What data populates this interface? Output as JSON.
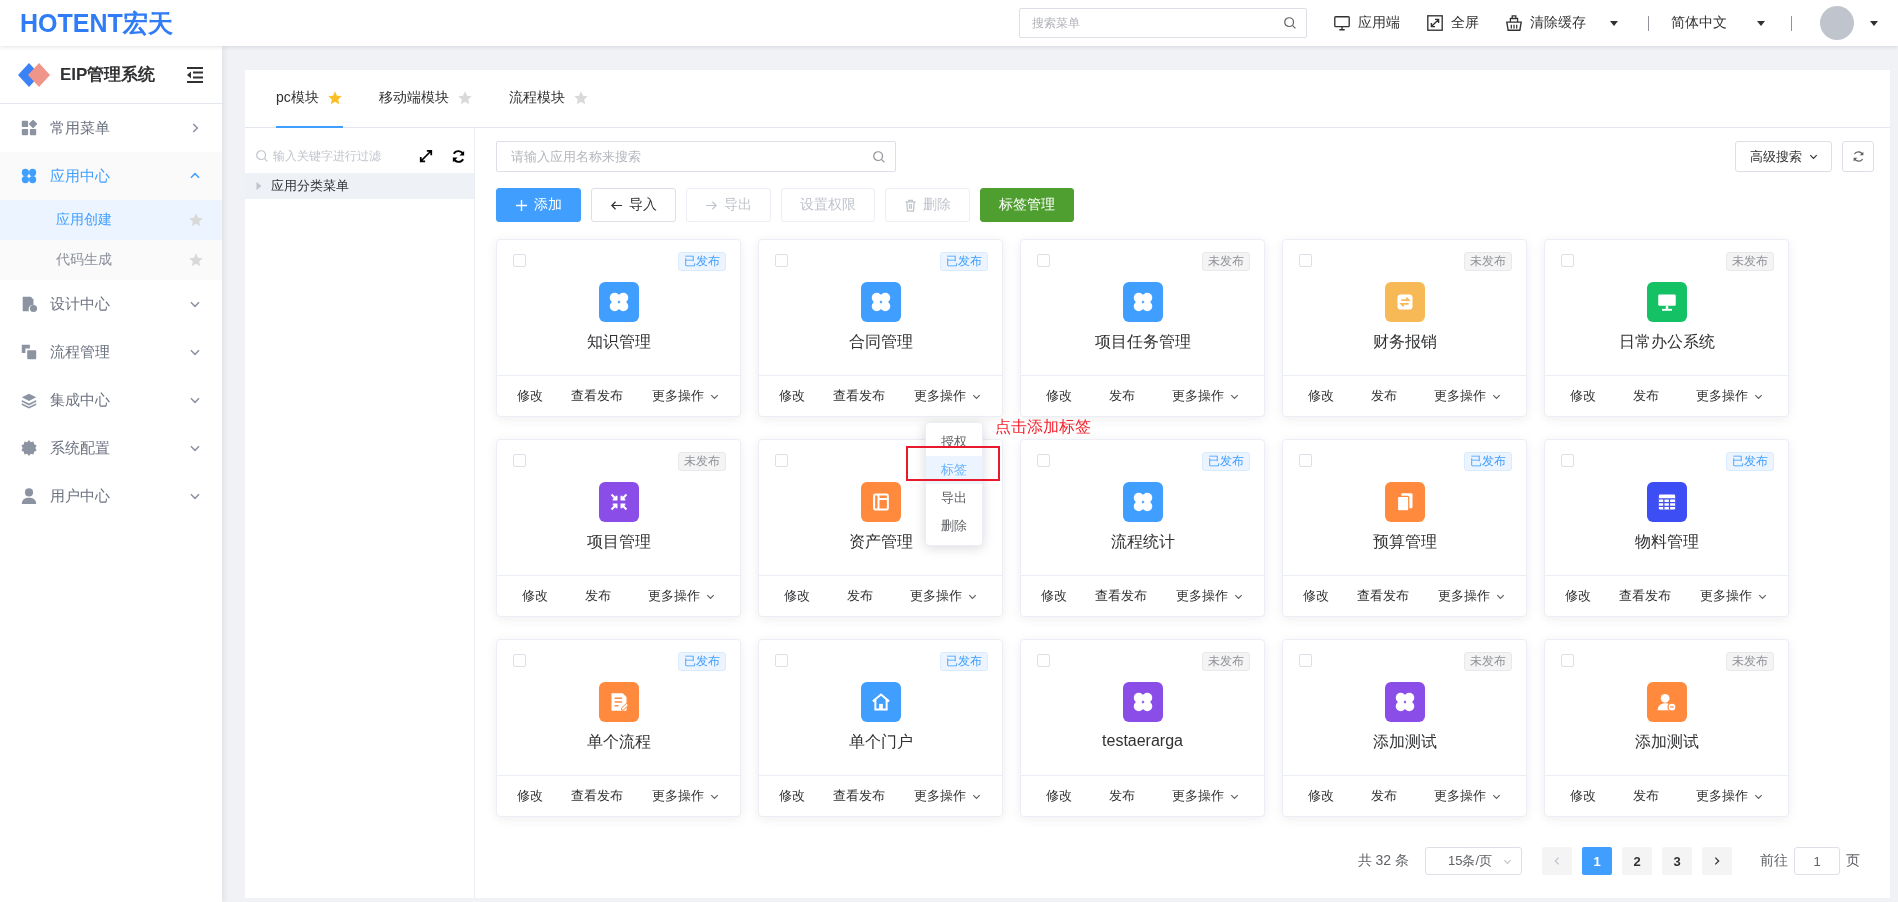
{
  "header": {
    "logo": "HOTENT宏天",
    "search": {
      "placeholder": "搜索菜单"
    },
    "actions": [
      {
        "label": "应用端",
        "caret": false
      },
      {
        "label": "全屏",
        "caret": false
      },
      {
        "label": "清除缓存",
        "caret": true
      }
    ],
    "language": {
      "label": "简体中文"
    }
  },
  "sidebar": {
    "title": "EIP管理系统",
    "items": [
      {
        "label": "常用菜单",
        "kind": "flyout",
        "expanded": false,
        "selected": false
      },
      {
        "label": "应用中心",
        "kind": "group",
        "expanded": true,
        "selected": true,
        "children": [
          {
            "label": "应用创建",
            "selected": true,
            "favorite": false
          },
          {
            "label": "代码生成",
            "selected": false,
            "favorite": false
          }
        ]
      },
      {
        "label": "设计中心",
        "kind": "group",
        "expanded": false,
        "selected": false
      },
      {
        "label": "流程管理",
        "kind": "group",
        "expanded": false,
        "selected": false
      },
      {
        "label": "集成中心",
        "kind": "group",
        "expanded": false,
        "selected": false
      },
      {
        "label": "系统配置",
        "kind": "group",
        "expanded": false,
        "selected": false
      },
      {
        "label": "用户中心",
        "kind": "group",
        "expanded": false,
        "selected": false
      }
    ]
  },
  "tabs": [
    {
      "label": "pc模块",
      "selected": true,
      "favorite": true
    },
    {
      "label": "移动端模块",
      "selected": false,
      "favorite": false
    },
    {
      "label": "流程模块",
      "selected": false,
      "favorite": false
    }
  ],
  "tree": {
    "filter": {
      "placeholder": "输入关键字进行过滤"
    },
    "nodes": [
      {
        "label": "应用分类菜单",
        "expanded": false,
        "selected": true
      }
    ]
  },
  "search": {
    "placeholder": "请输入应用名称来搜索"
  },
  "advanced_search": {
    "label": "高级搜索"
  },
  "toolbar": [
    {
      "label": "添加",
      "kind": "primary",
      "disabled": false
    },
    {
      "label": "导入",
      "kind": "default",
      "disabled": false
    },
    {
      "label": "导出",
      "kind": "default",
      "disabled": true
    },
    {
      "label": "设置权限",
      "kind": "default",
      "disabled": true
    },
    {
      "label": "删除",
      "kind": "default",
      "disabled": true
    },
    {
      "label": "标签管理",
      "kind": "success",
      "disabled": false
    }
  ],
  "cards": [
    {
      "name": "知识管理",
      "status": "已发布",
      "published": true,
      "checked": false,
      "color": "#409eff",
      "actions": [
        "修改",
        "查看发布",
        "更多操作"
      ]
    },
    {
      "name": "合同管理",
      "status": "已发布",
      "published": true,
      "checked": false,
      "color": "#409eff",
      "actions": [
        "修改",
        "查看发布",
        "更多操作"
      ]
    },
    {
      "name": "项目任务管理",
      "status": "未发布",
      "published": false,
      "checked": false,
      "color": "#409eff",
      "actions": [
        "修改",
        "发布",
        "更多操作"
      ]
    },
    {
      "name": "财务报销",
      "status": "未发布",
      "published": false,
      "checked": false,
      "color": "#f7b955",
      "actions": [
        "修改",
        "发布",
        "更多操作"
      ]
    },
    {
      "name": "日常办公系统",
      "status": "未发布",
      "published": false,
      "checked": false,
      "color": "#14c164",
      "actions": [
        "修改",
        "发布",
        "更多操作"
      ]
    },
    {
      "name": "项目管理",
      "status": "未发布",
      "published": false,
      "checked": false,
      "color": "#8b4de8",
      "actions": [
        "修改",
        "发布",
        "更多操作"
      ]
    },
    {
      "name": "资产管理",
      "checked": false,
      "color": "#ff8a3d",
      "actions": [
        "修改",
        "发布",
        "更多操作"
      ]
    },
    {
      "name": "流程统计",
      "status": "已发布",
      "published": true,
      "checked": false,
      "color": "#409eff",
      "actions": [
        "修改",
        "查看发布",
        "更多操作"
      ]
    },
    {
      "name": "预算管理",
      "status": "已发布",
      "published": true,
      "checked": false,
      "color": "#ff8a3d",
      "actions": [
        "修改",
        "查看发布",
        "更多操作"
      ]
    },
    {
      "name": "物料管理",
      "status": "已发布",
      "published": true,
      "checked": false,
      "color": "#3d4ef5",
      "actions": [
        "修改",
        "查看发布",
        "更多操作"
      ]
    },
    {
      "name": "单个流程",
      "status": "已发布",
      "published": true,
      "checked": false,
      "color": "#ff8a3d",
      "actions": [
        "修改",
        "查看发布",
        "更多操作"
      ]
    },
    {
      "name": "单个门户",
      "status": "已发布",
      "published": true,
      "checked": false,
      "color": "#409eff",
      "actions": [
        "修改",
        "查看发布",
        "更多操作"
      ]
    },
    {
      "name": "testaerarga",
      "status": "未发布",
      "published": false,
      "checked": false,
      "color": "#8b4de8",
      "actions": [
        "修改",
        "发布",
        "更多操作"
      ]
    },
    {
      "name": "添加测试",
      "status": "未发布",
      "published": false,
      "checked": false,
      "color": "#8b4de8",
      "actions": [
        "修改",
        "发布",
        "更多操作"
      ]
    },
    {
      "name": "添加测试",
      "status": "未发布",
      "published": false,
      "checked": false,
      "color": "#ff8a3d",
      "actions": [
        "修改",
        "发布",
        "更多操作"
      ]
    }
  ],
  "more_menu": {
    "items": [
      {
        "label": "授权",
        "selected": false
      },
      {
        "label": "标签",
        "selected": true
      },
      {
        "label": "导出",
        "selected": false
      },
      {
        "label": "删除",
        "selected": false
      }
    ],
    "annotation": "点击添加标签"
  },
  "pagination": {
    "total": "共 32 条",
    "page_size": "15条/页",
    "prev_disabled": true,
    "next_disabled": false,
    "pages": [
      {
        "label": "1",
        "selected": true
      },
      {
        "label": "2",
        "selected": false
      },
      {
        "label": "3",
        "selected": false
      }
    ],
    "jump": {
      "label": "前往",
      "value": "1",
      "suffix": "页"
    }
  }
}
